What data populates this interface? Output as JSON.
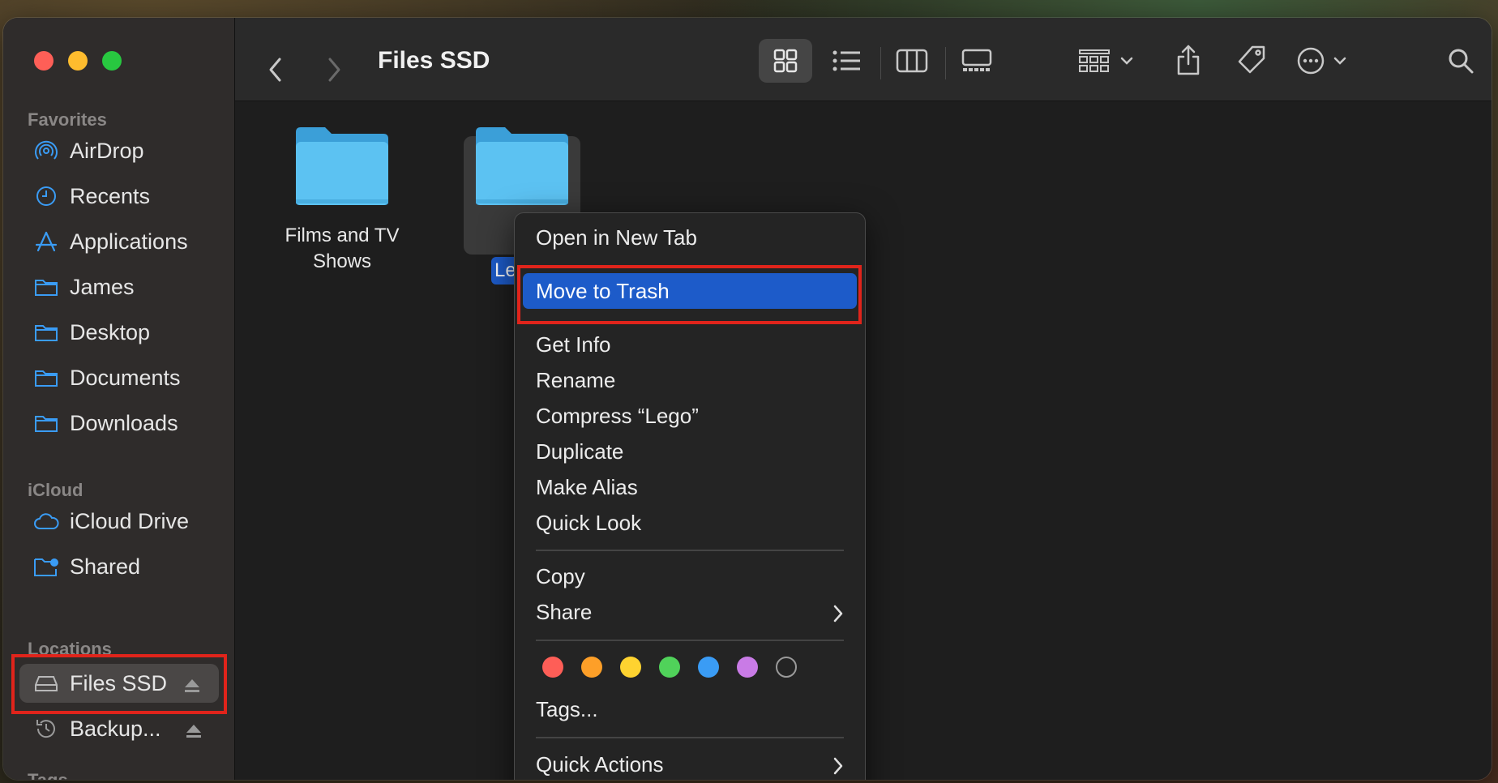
{
  "sidebar": {
    "favorites_label": "Favorites",
    "favorites": [
      {
        "label": "AirDrop",
        "icon": "airdrop-icon"
      },
      {
        "label": "Recents",
        "icon": "clock-icon"
      },
      {
        "label": "Applications",
        "icon": "applications-icon"
      },
      {
        "label": "James",
        "icon": "folder-icon"
      },
      {
        "label": "Desktop",
        "icon": "folder-icon"
      },
      {
        "label": "Documents",
        "icon": "folder-icon"
      },
      {
        "label": "Downloads",
        "icon": "folder-icon"
      }
    ],
    "icloud_label": "iCloud",
    "icloud": [
      {
        "label": "iCloud Drive",
        "icon": "cloud-icon"
      },
      {
        "label": "Shared",
        "icon": "shared-folder-icon"
      }
    ],
    "locations_label": "Locations",
    "locations": [
      {
        "label": "Files SSD",
        "icon": "drive-icon",
        "selected": true
      },
      {
        "label": "Backup...",
        "icon": "time-machine-icon"
      }
    ],
    "tags_label": "Tags"
  },
  "toolbar": {
    "title": "Files SSD",
    "icons": [
      "back-icon",
      "forward-icon",
      "icon-view-icon",
      "list-view-icon",
      "column-view-icon",
      "gallery-view-icon",
      "group-icon",
      "share-icon",
      "tag-icon",
      "more-icon",
      "search-icon"
    ]
  },
  "content": {
    "folders": [
      {
        "label_line1": "Films and TV",
        "label_line2": "Shows"
      },
      {
        "label": "Le"
      }
    ]
  },
  "context_menu": {
    "items": {
      "open_new_tab": "Open in New Tab",
      "move_to_trash": "Move to Trash",
      "get_info": "Get Info",
      "rename": "Rename",
      "compress": "Compress “Lego”",
      "duplicate": "Duplicate",
      "make_alias": "Make Alias",
      "quick_look": "Quick Look",
      "copy": "Copy",
      "share": "Share",
      "tags": "Tags...",
      "quick_actions": "Quick Actions"
    },
    "tag_colors": [
      "#fe5e57",
      "#fd9f28",
      "#fed330",
      "#50d25a",
      "#3a9cf5",
      "#c97be6",
      "none"
    ]
  },
  "colors": {
    "accent": "#1d5bc9",
    "highlight_box": "#e0241b",
    "folder_blue": "#5cc2f2"
  }
}
